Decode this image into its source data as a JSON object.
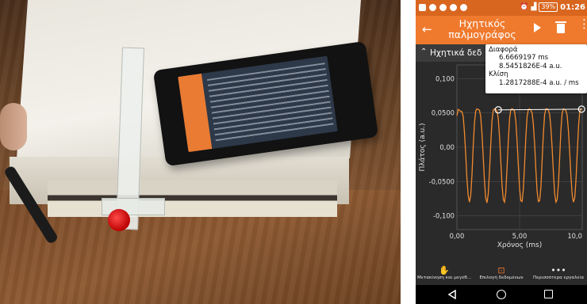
{
  "status_bar": {
    "battery": "39%",
    "time": "01:26"
  },
  "app_bar": {
    "title": "Ηχητικός παλμογράφος",
    "back_icon": "arrow-left-icon",
    "play_icon": "play-icon",
    "delete_icon": "trash-icon",
    "menu_icon": "more-vertical-icon"
  },
  "sub_header": {
    "label": "Ηχητικά δεδ"
  },
  "tooltip": {
    "difference_title": "Διαφορά",
    "difference_x": "6.6669197 ms",
    "difference_y": "8.5451826E-4 a.u.",
    "slope_title": "Κλίση",
    "slope_value": "1.2817288E-4 a.u. /  ms"
  },
  "chart_data": {
    "type": "line",
    "xlabel": "Χρόνος (ms)",
    "ylabel": "Πλάτος (a.u.)",
    "xlim": [
      0,
      10
    ],
    "ylim": [
      -0.12,
      0.12
    ],
    "x_ticks": [
      "0,00",
      "5,00",
      "10,0"
    ],
    "y_ticks": [
      "0,100",
      "0,0500",
      "0,00",
      "-0,0500",
      "-0,100"
    ],
    "y_tick_values": [
      0.1,
      0.05,
      0,
      -0.05,
      -0.1
    ],
    "x_tick_values": [
      0,
      5,
      10
    ],
    "series": [
      {
        "color": "#f28a2e",
        "x": [
          0.0,
          0.1,
          0.2,
          0.3,
          0.4,
          0.5,
          0.6,
          0.7,
          0.8,
          0.9,
          1.0,
          1.1,
          1.2,
          1.3,
          1.4,
          1.5,
          1.6,
          1.7,
          1.8,
          1.9,
          2.0,
          2.1,
          2.2,
          2.3,
          2.4,
          2.5,
          2.6,
          2.7,
          2.8,
          2.9,
          3.0,
          3.1,
          3.2,
          3.3,
          3.4,
          3.5,
          3.6,
          3.7,
          3.8,
          3.9,
          4.0,
          4.1,
          4.2,
          4.3,
          4.4,
          4.5,
          4.6,
          4.7,
          4.8,
          4.9,
          5.0,
          5.1,
          5.2,
          5.3,
          5.4,
          5.5,
          5.6,
          5.7,
          5.8,
          5.9,
          6.0,
          6.1,
          6.2,
          6.3,
          6.4,
          6.5,
          6.6,
          6.7,
          6.8,
          6.9,
          7.0,
          7.1,
          7.2,
          7.3,
          7.4,
          7.5,
          7.6,
          7.7,
          7.8,
          7.9,
          8.0,
          8.1,
          8.2,
          8.3,
          8.4,
          8.5,
          8.6,
          8.7,
          8.8,
          8.9,
          9.0,
          9.1,
          9.2,
          9.3,
          9.4,
          9.5,
          9.6,
          9.7,
          9.8,
          9.9,
          10.0
        ],
        "y": [
          0.046,
          0.055,
          0.054,
          0.052,
          0.052,
          0.045,
          0.022,
          -0.01,
          -0.045,
          -0.07,
          -0.08,
          -0.07,
          -0.04,
          0.0,
          0.035,
          0.053,
          0.056,
          0.055,
          0.054,
          0.045,
          0.02,
          -0.015,
          -0.05,
          -0.074,
          -0.081,
          -0.068,
          -0.035,
          0.005,
          0.038,
          0.054,
          0.056,
          0.055,
          0.053,
          0.042,
          0.016,
          -0.02,
          -0.055,
          -0.076,
          -0.08,
          -0.066,
          -0.03,
          0.01,
          0.042,
          0.055,
          0.056,
          0.055,
          0.052,
          0.038,
          0.01,
          -0.026,
          -0.06,
          -0.078,
          -0.079,
          -0.062,
          -0.025,
          0.015,
          0.045,
          0.055,
          0.056,
          0.054,
          0.05,
          0.033,
          0.004,
          -0.032,
          -0.064,
          -0.079,
          -0.078,
          -0.058,
          -0.02,
          0.02,
          0.048,
          0.056,
          0.056,
          0.054,
          0.048,
          0.028,
          -0.002,
          -0.038,
          -0.067,
          -0.08,
          -0.076,
          -0.053,
          -0.014,
          0.025,
          0.05,
          0.056,
          0.055,
          0.053,
          0.046,
          0.024,
          -0.008,
          -0.043,
          -0.07,
          -0.08,
          -0.074,
          -0.048,
          -0.008,
          0.03,
          0.051,
          0.056,
          0.055
        ]
      }
    ],
    "markers": [
      {
        "x": 3.3,
        "y": 0.0545
      },
      {
        "x": 9.95,
        "y": 0.0555
      }
    ],
    "grid": true
  },
  "toolbar": {
    "items": [
      {
        "label": "Μετακίνηση και μεγέθ...",
        "icon": "hand-icon"
      },
      {
        "label": "Επιλογή δεδομένων",
        "icon": "select-data-icon"
      },
      {
        "label": "Περισσότερα εργαλεία",
        "icon": "more-horizontal-icon"
      }
    ]
  },
  "nav_bar": {
    "back_icon": "nav-back-icon",
    "home_icon": "nav-home-icon",
    "recents_icon": "nav-recents-icon"
  }
}
